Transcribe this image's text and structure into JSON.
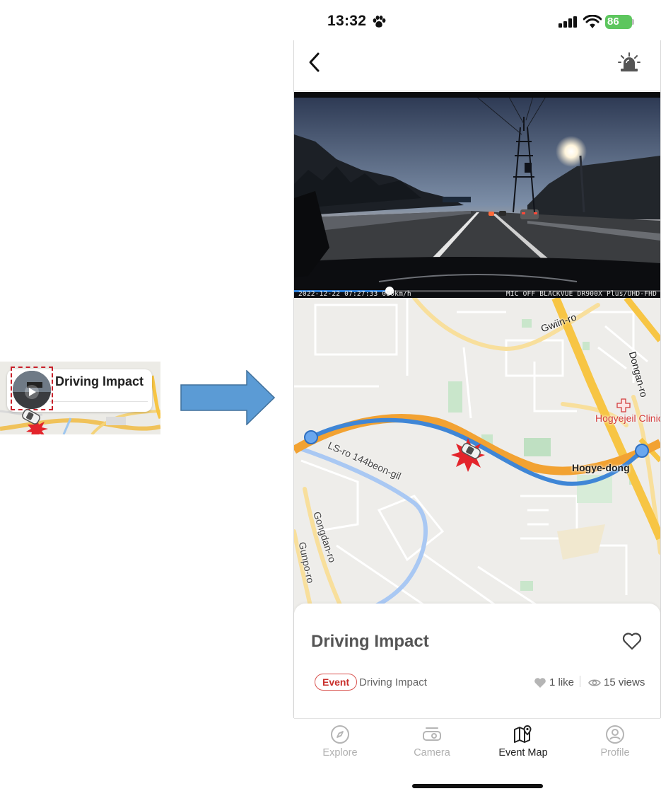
{
  "preview": {
    "title": "Driving Impact"
  },
  "status_bar": {
    "time": "13:32",
    "battery": "86"
  },
  "nav": {
    "back_icon": "chevron-left-icon",
    "siren_icon": "siren-icon"
  },
  "video": {
    "osd_left": "2022-12-22 07:27:33 080km/h",
    "osd_right": "MIC OFF BLACKVUE DR900X Plus/UHD-FHD",
    "progress": 0.26
  },
  "map": {
    "labels": {
      "gwiin_ro": "Gwiin-ro",
      "dongan_ro": "Dongan-ro",
      "clinic": "Hogyejeil Clinic",
      "hogye_dong": "Hogye-dong",
      "ls_ro": "LS-ro 144beon-gil",
      "gongdan_ro": "Gongdan-ro",
      "gunpo_ro": "Gunpo-ro"
    },
    "colors": {
      "route": "#3f86d6",
      "major_road": "#f7c544",
      "clinic": "#d23c3c"
    }
  },
  "detail": {
    "title": "Driving Impact",
    "tag": "Event",
    "event_type": "Driving Impact",
    "likes": "1 like",
    "views": "15 views"
  },
  "tabs": [
    {
      "label": "Explore",
      "icon": "compass-icon",
      "active": false
    },
    {
      "label": "Camera",
      "icon": "dashcam-icon",
      "active": false
    },
    {
      "label": "Event Map",
      "icon": "map-pin-icon",
      "active": true
    },
    {
      "label": "Profile",
      "icon": "user-icon",
      "active": false
    }
  ]
}
